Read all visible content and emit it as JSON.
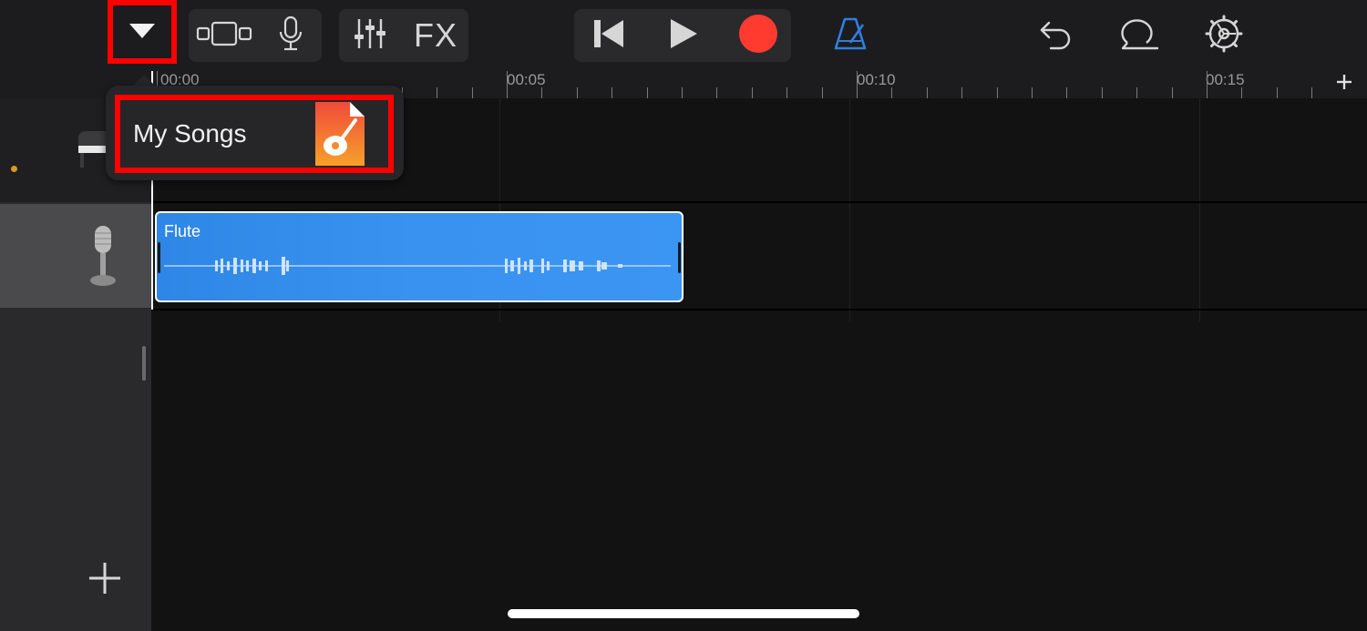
{
  "toolbar": {
    "menu_button": {
      "icon": "triangle-down-icon"
    },
    "tracks_view_button": {
      "icon": "tracks-view-icon"
    },
    "instrument_button": {
      "icon": "microphone-icon"
    },
    "mixer_button": {
      "icon": "sliders-icon"
    },
    "fx_label": "FX",
    "rewind_button": {
      "icon": "skip-back-icon"
    },
    "play_button": {
      "icon": "play-icon"
    },
    "record_button": {
      "icon": "record-icon",
      "color": "#ff3b30"
    },
    "metronome_button": {
      "icon": "metronome-icon",
      "color": "#2f7fe0"
    },
    "undo_button": {
      "icon": "undo-icon"
    },
    "loop_button": {
      "icon": "loop-icon"
    },
    "settings_button": {
      "icon": "gear-icon"
    }
  },
  "ruler": {
    "labels": [
      "00:00",
      "00:05",
      "00:10",
      "00:15"
    ],
    "add_section_icon": "plus-icon"
  },
  "popover": {
    "item_label": "My Songs",
    "item_icon": "garageband-icon"
  },
  "tracks": [
    {
      "instrument_icon": "piano-icon",
      "regions": []
    },
    {
      "instrument_icon": "microphone-icon",
      "regions": [
        {
          "name": "Flute"
        }
      ]
    }
  ],
  "add_track_icon": "plus-icon",
  "colors": {
    "region": "#3a92f0",
    "highlight": "#ff0000",
    "record": "#ff3b30",
    "metronome": "#2f7fe0",
    "status_dot": "#d89a1f"
  }
}
